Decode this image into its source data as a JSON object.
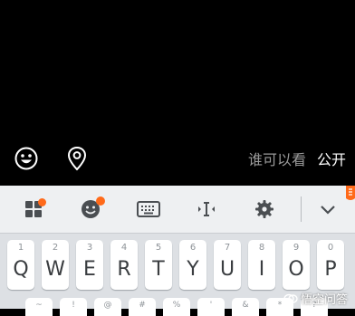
{
  "compose": {
    "visibility_label": "谁可以看",
    "visibility_value": "公开"
  },
  "toolbar": {
    "icons": [
      "apps-grid-icon",
      "emoji-icon",
      "keyboard-icon",
      "cursor-move-icon",
      "settings-gear-icon",
      "chevron-down-icon"
    ],
    "accent_color": "#ff6a1a"
  },
  "keyboard": {
    "row1": [
      {
        "char": "Q",
        "hint": "1"
      },
      {
        "char": "W",
        "hint": "2"
      },
      {
        "char": "E",
        "hint": "3"
      },
      {
        "char": "R",
        "hint": "4"
      },
      {
        "char": "T",
        "hint": "5"
      },
      {
        "char": "Y",
        "hint": "6"
      },
      {
        "char": "U",
        "hint": "7"
      },
      {
        "char": "I",
        "hint": "8"
      },
      {
        "char": "O",
        "hint": "9"
      },
      {
        "char": "P",
        "hint": "0"
      }
    ],
    "row2_hints": [
      "~",
      "!",
      "@",
      "#",
      "%",
      "'",
      "&",
      "*",
      "?"
    ]
  },
  "watermark": {
    "text": "悟空问答"
  }
}
